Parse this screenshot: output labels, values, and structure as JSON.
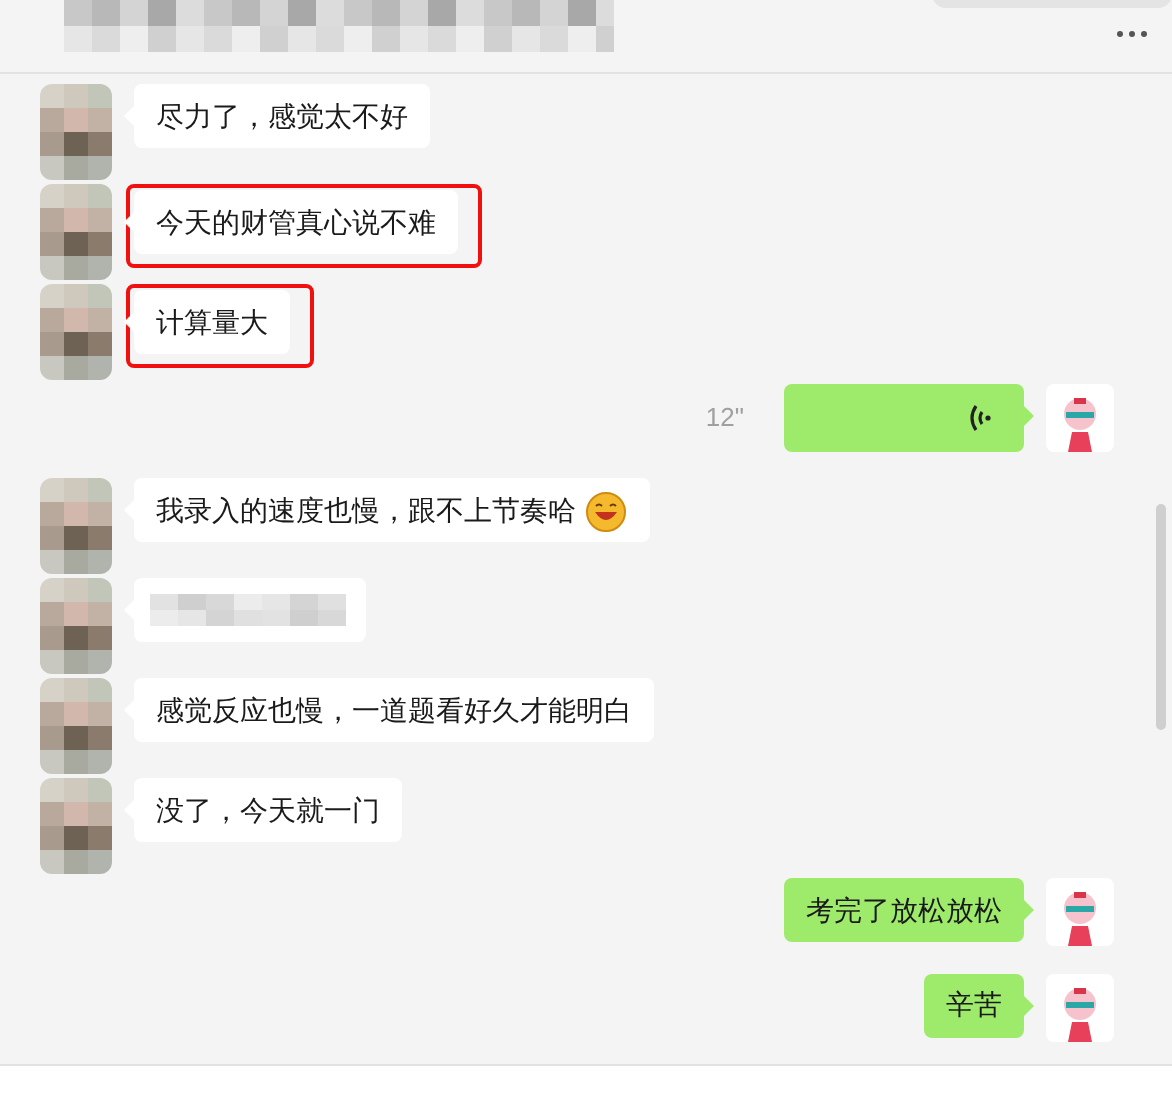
{
  "messages": [
    {
      "outgoing": false,
      "kind": "text",
      "text": "尽力了，感觉太不好",
      "highlighted": false
    },
    {
      "outgoing": false,
      "kind": "text",
      "text": "今天的财管真心说不难",
      "highlighted": true
    },
    {
      "outgoing": false,
      "kind": "text",
      "text": "计算量大",
      "highlighted": true
    },
    {
      "outgoing": true,
      "kind": "voice",
      "duration": "12\""
    },
    {
      "outgoing": false,
      "kind": "text",
      "text": "我录入的速度也慢，跟不上节奏哈",
      "highlighted": false,
      "emoji": true
    },
    {
      "outgoing": false,
      "kind": "blurred"
    },
    {
      "outgoing": false,
      "kind": "text",
      "text": "感觉反应也慢，一道题看好久才能明白",
      "highlighted": false
    },
    {
      "outgoing": false,
      "kind": "text",
      "text": "没了，今天就一门",
      "highlighted": false
    },
    {
      "outgoing": true,
      "kind": "text",
      "text": "考完了放松放松",
      "highlighted": false
    },
    {
      "outgoing": true,
      "kind": "text",
      "text": "辛苦",
      "highlighted": false
    }
  ]
}
